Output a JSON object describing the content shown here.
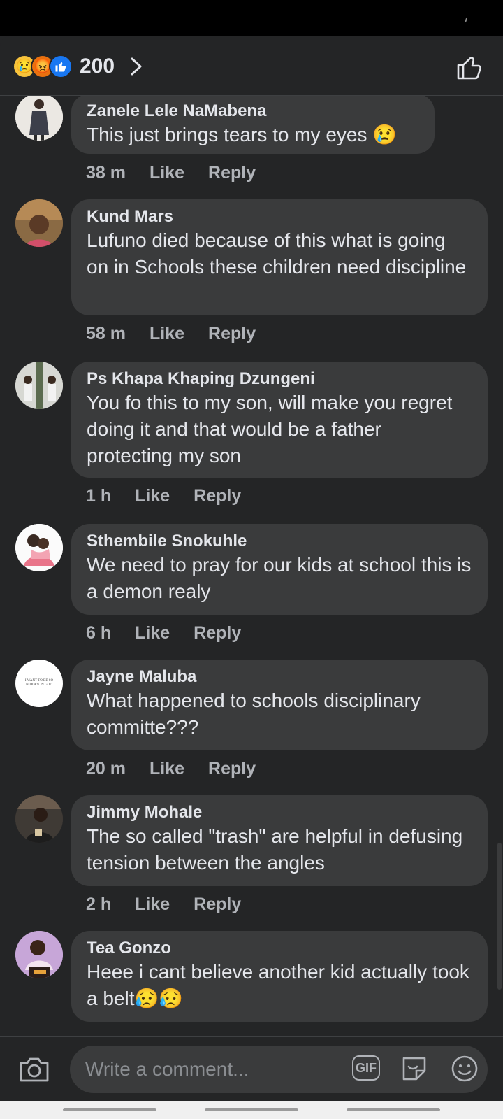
{
  "header": {
    "reaction_icons": [
      "sad-icon",
      "angry-icon",
      "like-icon"
    ],
    "reaction_count": "200"
  },
  "comments": [
    {
      "author": "Zanele Lele NaMabena",
      "text": "This just brings tears to my eyes 😢",
      "time": "38 m",
      "like": "Like",
      "reply": "Reply"
    },
    {
      "author": "Kund Mars",
      "text": "Lufuno died because of this what is going on in Schools these children need discipline",
      "time": "58 m",
      "like": "Like",
      "reply": "Reply"
    },
    {
      "author": "Ps Khapa Khaping Dzungeni",
      "text": "You fo this to my son, will make you regret doing it and that would be a father protecting my son",
      "time": "1 h",
      "like": "Like",
      "reply": "Reply"
    },
    {
      "author": "Sthembile Snokuhle",
      "text": "We need to pray for our kids at school this is a demon realy",
      "time": "6 h",
      "like": "Like",
      "reply": "Reply"
    },
    {
      "author": "Jayne Maluba",
      "text": "What happened to schools disciplinary committe???",
      "time": "20 m",
      "like": "Like",
      "reply": "Reply"
    },
    {
      "author": "Jimmy Mohale",
      "text": "The so called \"trash\" are helpful in defusing tension between the angles",
      "time": "2 h",
      "like": "Like",
      "reply": "Reply"
    },
    {
      "author": "Tea Gonzo",
      "text": "Heee i cant believe another kid actually took a belt😥😥",
      "time": "",
      "like": "",
      "reply": ""
    }
  ],
  "avatar_5_text": "I WANT TO BE SO HIDDEN IN GOD",
  "composer": {
    "placeholder": "Write a comment...",
    "gif_label": "GIF"
  },
  "colors": {
    "background": "#242526",
    "bubble": "#3a3b3c",
    "text": "#e4e6eb",
    "meta": "#b0b3b8",
    "like_blue": "#1877f2"
  }
}
